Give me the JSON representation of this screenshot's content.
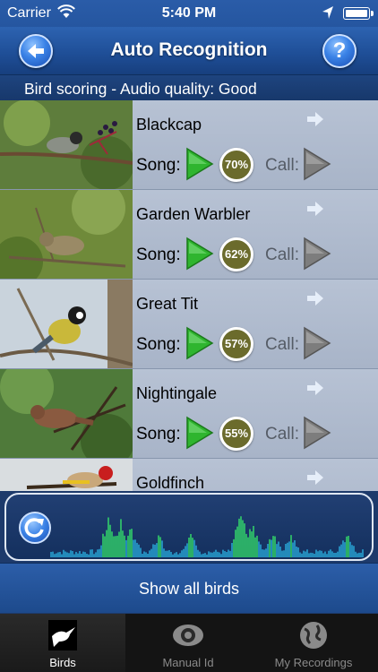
{
  "status_bar": {
    "carrier": "Carrier",
    "time": "5:40 PM"
  },
  "nav": {
    "title": "Auto Recognition",
    "back_icon": "arrow-left-icon",
    "help_label": "?"
  },
  "header": {
    "text": "Bird scoring - Audio quality: Good"
  },
  "birds": [
    {
      "name": "Blackcap",
      "song_label": "Song:",
      "score": "70%",
      "call_label": "Call:"
    },
    {
      "name": "Garden Warbler",
      "song_label": "Song:",
      "score": "62%",
      "call_label": "Call:"
    },
    {
      "name": "Great Tit",
      "song_label": "Song:",
      "score": "57%",
      "call_label": "Call:"
    },
    {
      "name": "Nightingale",
      "song_label": "Song:",
      "score": "55%",
      "call_label": "Call:"
    },
    {
      "name": "Goldfinch"
    }
  ],
  "show_all": "Show all birds",
  "tabs": [
    {
      "label": "Birds",
      "icon": "bird-icon",
      "active": true
    },
    {
      "label": "Manual Id",
      "icon": "eye-icon",
      "active": false
    },
    {
      "label": "My Recordings",
      "icon": "globe-icon",
      "active": false
    }
  ],
  "colors": {
    "accent": "#2556a0",
    "score_badge": "#6b6b2c",
    "play_green": "#2fb52f",
    "wave_green": "#35e36a",
    "wave_blue": "#2ab0e0"
  }
}
